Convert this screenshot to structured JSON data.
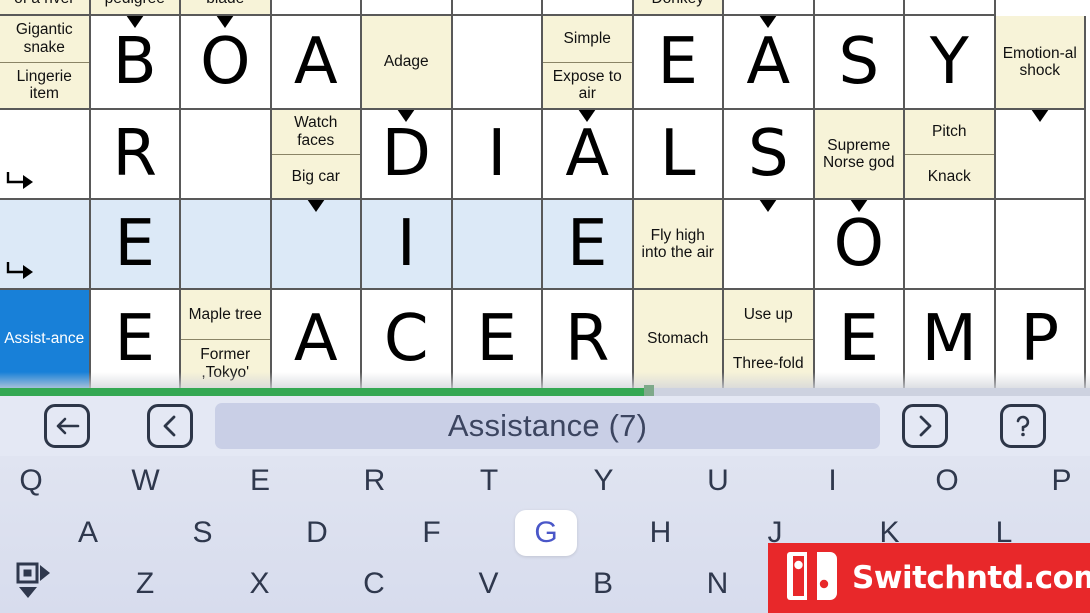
{
  "app": {
    "name": "crossword-puzzle-game",
    "watermark_text": "Switchntd.com",
    "accent_active": "#1880d8",
    "accent_progress": "#34a853",
    "clue_cell_color": "#f7f3d8",
    "highlight_row_color": "#dce9f7"
  },
  "grid": {
    "columns": 11,
    "rows": 6,
    "cells": [
      {
        "id": "r0c0",
        "type": "clue",
        "col": 0,
        "row": 0,
        "lines": [
          "of a river"
        ]
      },
      {
        "id": "r0c1",
        "type": "clue",
        "col": 1,
        "row": 0,
        "lines": [
          "pedigree"
        ]
      },
      {
        "id": "r0c2",
        "type": "clue",
        "col": 2,
        "row": 0,
        "lines": [
          "blade"
        ]
      },
      {
        "id": "r0c3",
        "type": "white",
        "col": 3,
        "row": 0,
        "letter": ""
      },
      {
        "id": "r0c4",
        "type": "white",
        "col": 4,
        "row": 0,
        "letter": ""
      },
      {
        "id": "r0c5",
        "type": "white",
        "col": 5,
        "row": 0,
        "letter": ""
      },
      {
        "id": "r0c6",
        "type": "white",
        "col": 6,
        "row": 0,
        "letter": ""
      },
      {
        "id": "r0c7",
        "type": "clue",
        "col": 7,
        "row": 0,
        "lines": [
          "Donkey"
        ]
      },
      {
        "id": "r0c8",
        "type": "white",
        "col": 8,
        "row": 0,
        "letter": ""
      },
      {
        "id": "r0c9",
        "type": "white",
        "col": 9,
        "row": 0,
        "letter": ""
      },
      {
        "id": "r0c10",
        "type": "white",
        "col": 10,
        "row": 0,
        "letter": ""
      },
      {
        "id": "r1c0",
        "type": "clue",
        "col": 0,
        "row": 1,
        "lines": [
          "Gigantic snake",
          "Lingerie item"
        ],
        "arrow_right": true
      },
      {
        "id": "r1c1",
        "type": "white",
        "col": 1,
        "row": 1,
        "letter": "B",
        "arrow_down": true
      },
      {
        "id": "r1c2",
        "type": "white",
        "col": 2,
        "row": 1,
        "letter": "O",
        "arrow_down": true
      },
      {
        "id": "r1c3",
        "type": "white",
        "col": 3,
        "row": 1,
        "letter": "A"
      },
      {
        "id": "r1c4",
        "type": "clue",
        "col": 4,
        "row": 1,
        "lines": [
          "Adage"
        ]
      },
      {
        "id": "r1c5",
        "type": "white",
        "col": 5,
        "row": 1,
        "letter": ""
      },
      {
        "id": "r1c6",
        "type": "clue",
        "col": 6,
        "row": 1,
        "lines": [
          "Simple",
          "Expose to air"
        ],
        "arrow_right": true
      },
      {
        "id": "r1c7",
        "type": "white",
        "col": 7,
        "row": 1,
        "letter": "E"
      },
      {
        "id": "r1c8",
        "type": "white",
        "col": 8,
        "row": 1,
        "letter": "A",
        "arrow_down": true
      },
      {
        "id": "r1c9",
        "type": "white",
        "col": 9,
        "row": 1,
        "letter": "S"
      },
      {
        "id": "r1c10",
        "type": "white",
        "col": 10,
        "row": 1,
        "letter": "Y"
      },
      {
        "id": "r1c11",
        "type": "clue",
        "col": 11,
        "row": 1,
        "lines": [
          "Emotion-al shock"
        ]
      },
      {
        "id": "r2c0",
        "type": "white",
        "col": 0,
        "row": 2,
        "letter": "",
        "arrow_elbow": true
      },
      {
        "id": "r2c1",
        "type": "white",
        "col": 1,
        "row": 2,
        "letter": "R"
      },
      {
        "id": "r2c2",
        "type": "white",
        "col": 2,
        "row": 2,
        "letter": ""
      },
      {
        "id": "r2c3",
        "type": "clue",
        "col": 3,
        "row": 2,
        "lines": [
          "Watch faces",
          "Big car"
        ],
        "arrow_right": true
      },
      {
        "id": "r2c4",
        "type": "white",
        "col": 4,
        "row": 2,
        "letter": "D",
        "arrow_down": true
      },
      {
        "id": "r2c5",
        "type": "white",
        "col": 5,
        "row": 2,
        "letter": "I"
      },
      {
        "id": "r2c6",
        "type": "white",
        "col": 6,
        "row": 2,
        "letter": "A",
        "arrow_down": true
      },
      {
        "id": "r2c7",
        "type": "white",
        "col": 7,
        "row": 2,
        "letter": "L"
      },
      {
        "id": "r2c8",
        "type": "white",
        "col": 8,
        "row": 2,
        "letter": "S"
      },
      {
        "id": "r2c9",
        "type": "clue",
        "col": 9,
        "row": 2,
        "lines": [
          "Supreme Norse god"
        ]
      },
      {
        "id": "r2c10",
        "type": "clue",
        "col": 10,
        "row": 2,
        "lines": [
          "Pitch",
          "Knack"
        ],
        "arrow_right": true
      },
      {
        "id": "r2c11",
        "type": "white",
        "col": 11,
        "row": 2,
        "letter": "",
        "arrow_down": true
      },
      {
        "id": "r3c0",
        "type": "hl",
        "col": 0,
        "row": 3,
        "letter": "",
        "arrow_elbow": true
      },
      {
        "id": "r3c1",
        "type": "hl",
        "col": 1,
        "row": 3,
        "letter": "E"
      },
      {
        "id": "r3c2",
        "type": "hl",
        "col": 2,
        "row": 3,
        "letter": ""
      },
      {
        "id": "r3c3",
        "type": "hl",
        "col": 3,
        "row": 3,
        "letter": "",
        "arrow_down": true
      },
      {
        "id": "r3c4",
        "type": "hl",
        "col": 4,
        "row": 3,
        "letter": "I"
      },
      {
        "id": "r3c5",
        "type": "hl",
        "col": 5,
        "row": 3,
        "letter": ""
      },
      {
        "id": "r3c6",
        "type": "hl",
        "col": 6,
        "row": 3,
        "letter": "E"
      },
      {
        "id": "r3c7",
        "type": "clue",
        "col": 7,
        "row": 3,
        "lines": [
          "Fly high into the air"
        ],
        "arrow_right": true
      },
      {
        "id": "r3c8",
        "type": "white",
        "col": 8,
        "row": 3,
        "letter": "",
        "arrow_down": true
      },
      {
        "id": "r3c9",
        "type": "white",
        "col": 9,
        "row": 3,
        "letter": "O",
        "arrow_down": true
      },
      {
        "id": "r3c10",
        "type": "white",
        "col": 10,
        "row": 3,
        "letter": ""
      },
      {
        "id": "r3c11",
        "type": "white",
        "col": 11,
        "row": 3,
        "letter": ""
      },
      {
        "id": "r4c0",
        "type": "active",
        "col": 0,
        "row": 4,
        "lines": [
          "Assist-ance"
        ]
      },
      {
        "id": "r4c1",
        "type": "white",
        "col": 1,
        "row": 4,
        "letter": "E"
      },
      {
        "id": "r4c2",
        "type": "clue",
        "col": 2,
        "row": 4,
        "lines": [
          "Maple tree",
          "Former ,Tokyo'"
        ],
        "arrow_right": true
      },
      {
        "id": "r4c3",
        "type": "white",
        "col": 3,
        "row": 4,
        "letter": "A"
      },
      {
        "id": "r4c4",
        "type": "white",
        "col": 4,
        "row": 4,
        "letter": "C"
      },
      {
        "id": "r4c5",
        "type": "white",
        "col": 5,
        "row": 4,
        "letter": "E"
      },
      {
        "id": "r4c6",
        "type": "white",
        "col": 6,
        "row": 4,
        "letter": "R"
      },
      {
        "id": "r4c7",
        "type": "clue",
        "col": 7,
        "row": 4,
        "lines": [
          "Stomach"
        ]
      },
      {
        "id": "r4c8",
        "type": "clue",
        "col": 8,
        "row": 4,
        "lines": [
          "Use up",
          "Three-fold"
        ],
        "arrow_right": true
      },
      {
        "id": "r4c9",
        "type": "white",
        "col": 9,
        "row": 4,
        "letter": "E"
      },
      {
        "id": "r4c10",
        "type": "white",
        "col": 10,
        "row": 4,
        "letter": "M"
      },
      {
        "id": "r4c11",
        "type": "white",
        "col": 11,
        "row": 4,
        "letter": "P"
      }
    ],
    "progress_percent": 60
  },
  "toolbar": {
    "back_icon": "arrow-left-icon",
    "prev_icon": "chevron-left-icon",
    "next_icon": "chevron-right-icon",
    "help_icon": "question-mark-icon",
    "current_clue": "Assistance (7)"
  },
  "keyboard": {
    "row1": [
      "Q",
      "W",
      "E",
      "R",
      "T",
      "Y",
      "U",
      "I",
      "O",
      "P"
    ],
    "row2": [
      "A",
      "S",
      "D",
      "F",
      "G",
      "H",
      "J",
      "K",
      "L"
    ],
    "row3": [
      "Z",
      "X",
      "C",
      "V",
      "B",
      "N"
    ],
    "selected_key": "G",
    "mode_icon": "keyboard-mode-icon"
  }
}
